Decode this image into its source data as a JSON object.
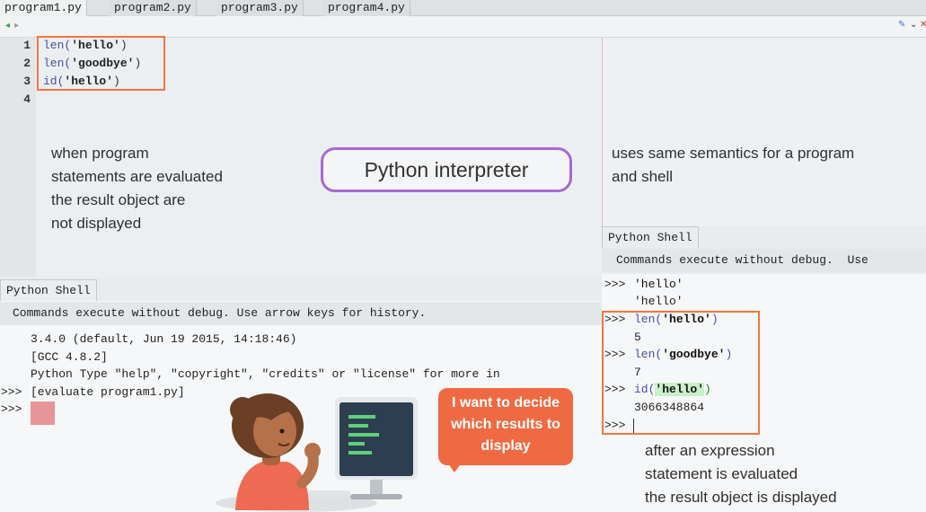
{
  "tabs": [
    "program1.py",
    "program2.py",
    "program3.py",
    "program4.py"
  ],
  "editor": {
    "line_numbers": [
      "1",
      "2",
      "3",
      "4"
    ],
    "lines": [
      {
        "fn": "len(",
        "arg": "'hello'",
        "close": ")"
      },
      {
        "fn": "len(",
        "arg": "'goodbye'",
        "close": ")"
      },
      {
        "fn": "id(",
        "arg": "'hello'",
        "close": ")"
      }
    ]
  },
  "notes": {
    "left": [
      "when program",
      "statements are evaluated",
      "the result object are",
      "not displayed"
    ],
    "interpreter": "Python interpreter",
    "right_top": [
      "uses same semantics for a program",
      "and shell"
    ],
    "right_bottom": [
      "after an expression",
      "statement is evaluated",
      "the result object is displayed"
    ]
  },
  "left_shell": {
    "tab": "Python Shell",
    "header": "Commands execute without debug.  Use arrow keys for history.",
    "lines": [
      "3.4.0 (default, Jun 19 2015, 14:18:46)",
      "[GCC 4.8.2]",
      "Python Type \"help\", \"copyright\", \"credits\" or \"license\" for more in"
    ],
    "prompt": ">>>",
    "command": "[evaluate program1.py]"
  },
  "right_shell": {
    "tab": "Python Shell",
    "header": "Commands execute without debug.  Use",
    "prompt": ">>>",
    "entries": [
      {
        "input_fn": "",
        "input_arg": "'hello'",
        "input_close": "",
        "output": "'hello'"
      },
      {
        "input_fn": "len(",
        "input_arg": "'hello'",
        "input_close": ")",
        "output": "5"
      },
      {
        "input_fn": "len(",
        "input_arg": "'goodbye'",
        "input_close": ")",
        "output": "7"
      },
      {
        "input_fn": "id(",
        "input_arg": "'hello'",
        "input_close": ")",
        "output": "3066348864"
      }
    ]
  },
  "bubble": [
    "I want to decide",
    "which results to",
    "display"
  ],
  "colors": {
    "accent_box": "#f2763f",
    "interpreter_border": "#a56ad0",
    "bubble": "#ef6a42"
  }
}
